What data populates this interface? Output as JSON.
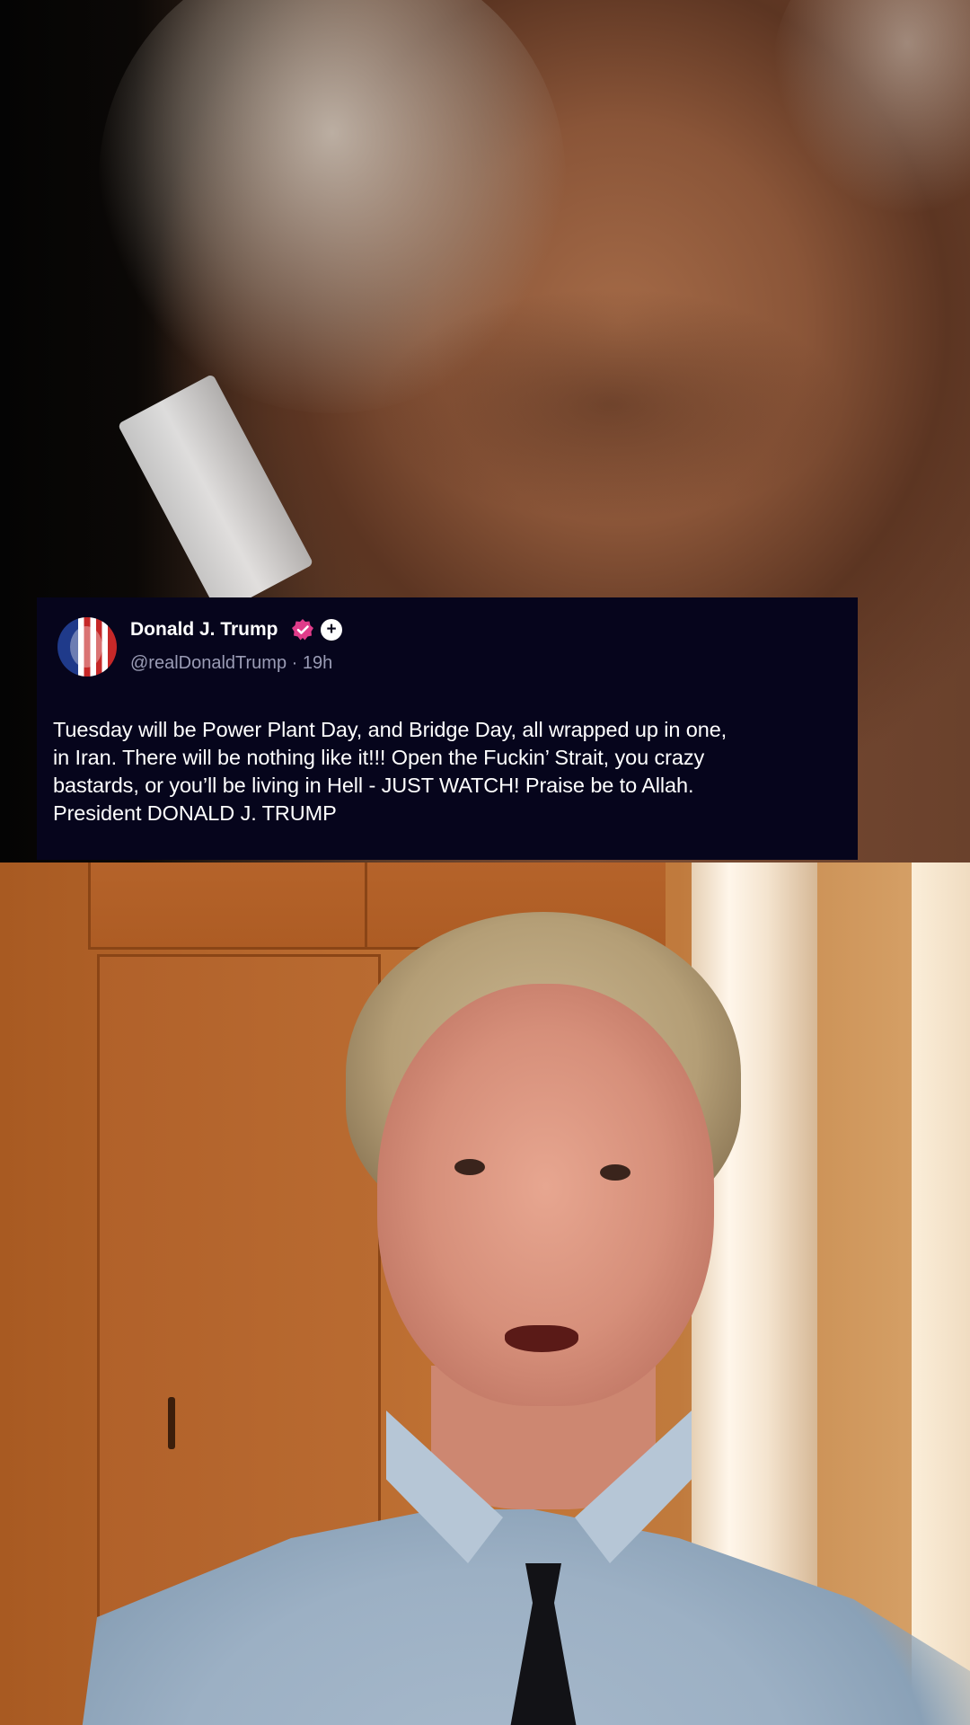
{
  "post": {
    "author_name": "Donald J. Trump",
    "verified_icon": "verified-badge-icon",
    "follow_icon": "plus-icon",
    "follow_symbol": "+",
    "handle": "@realDonaldTrump",
    "separator": "·",
    "time_ago": "19h",
    "body_lines": [
      "Tuesday will be Power Plant Day, and Bridge Day, all wrapped up in one,",
      "in Iran. There will be nothing like it!!! Open the Fuckin’ Strait, you crazy",
      "bastards, or you’ll be living in Hell - JUST WATCH! Praise be to Allah.",
      "President DONALD J. TRUMP"
    ]
  },
  "colors": {
    "card_background": "#06051c",
    "verified_badge": "#e03c8a",
    "meta_text": "#9a9cb5"
  }
}
